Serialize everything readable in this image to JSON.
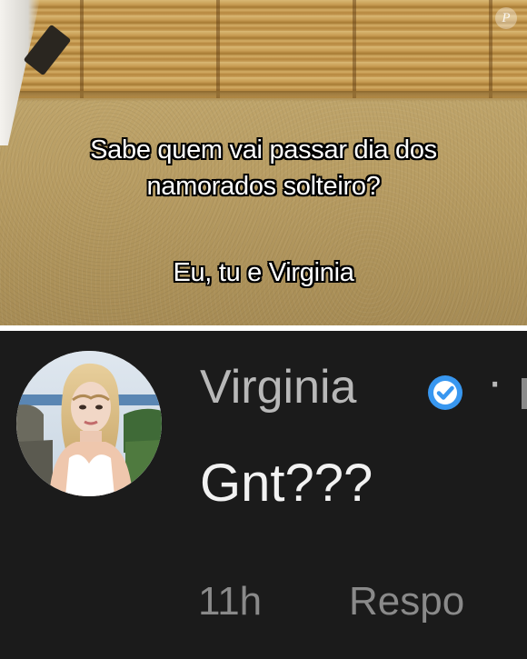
{
  "video": {
    "caption_line1": "Sabe quem vai passar dia dos",
    "caption_line2": "namorados solteiro?",
    "caption_line3": "Eu, tu e Virginia",
    "watermark": "P"
  },
  "comment": {
    "username": "Virginia",
    "separator": "·",
    "text": "Gnt???",
    "time": "11h",
    "reply_label": "Respo",
    "verified_badge_color": "#3897f0",
    "avatar_icon": "profile-photo"
  },
  "colors": {
    "comment_bg": "#1b1b1b",
    "username": "#b8b8b8",
    "meta": "#8a8a8a"
  }
}
